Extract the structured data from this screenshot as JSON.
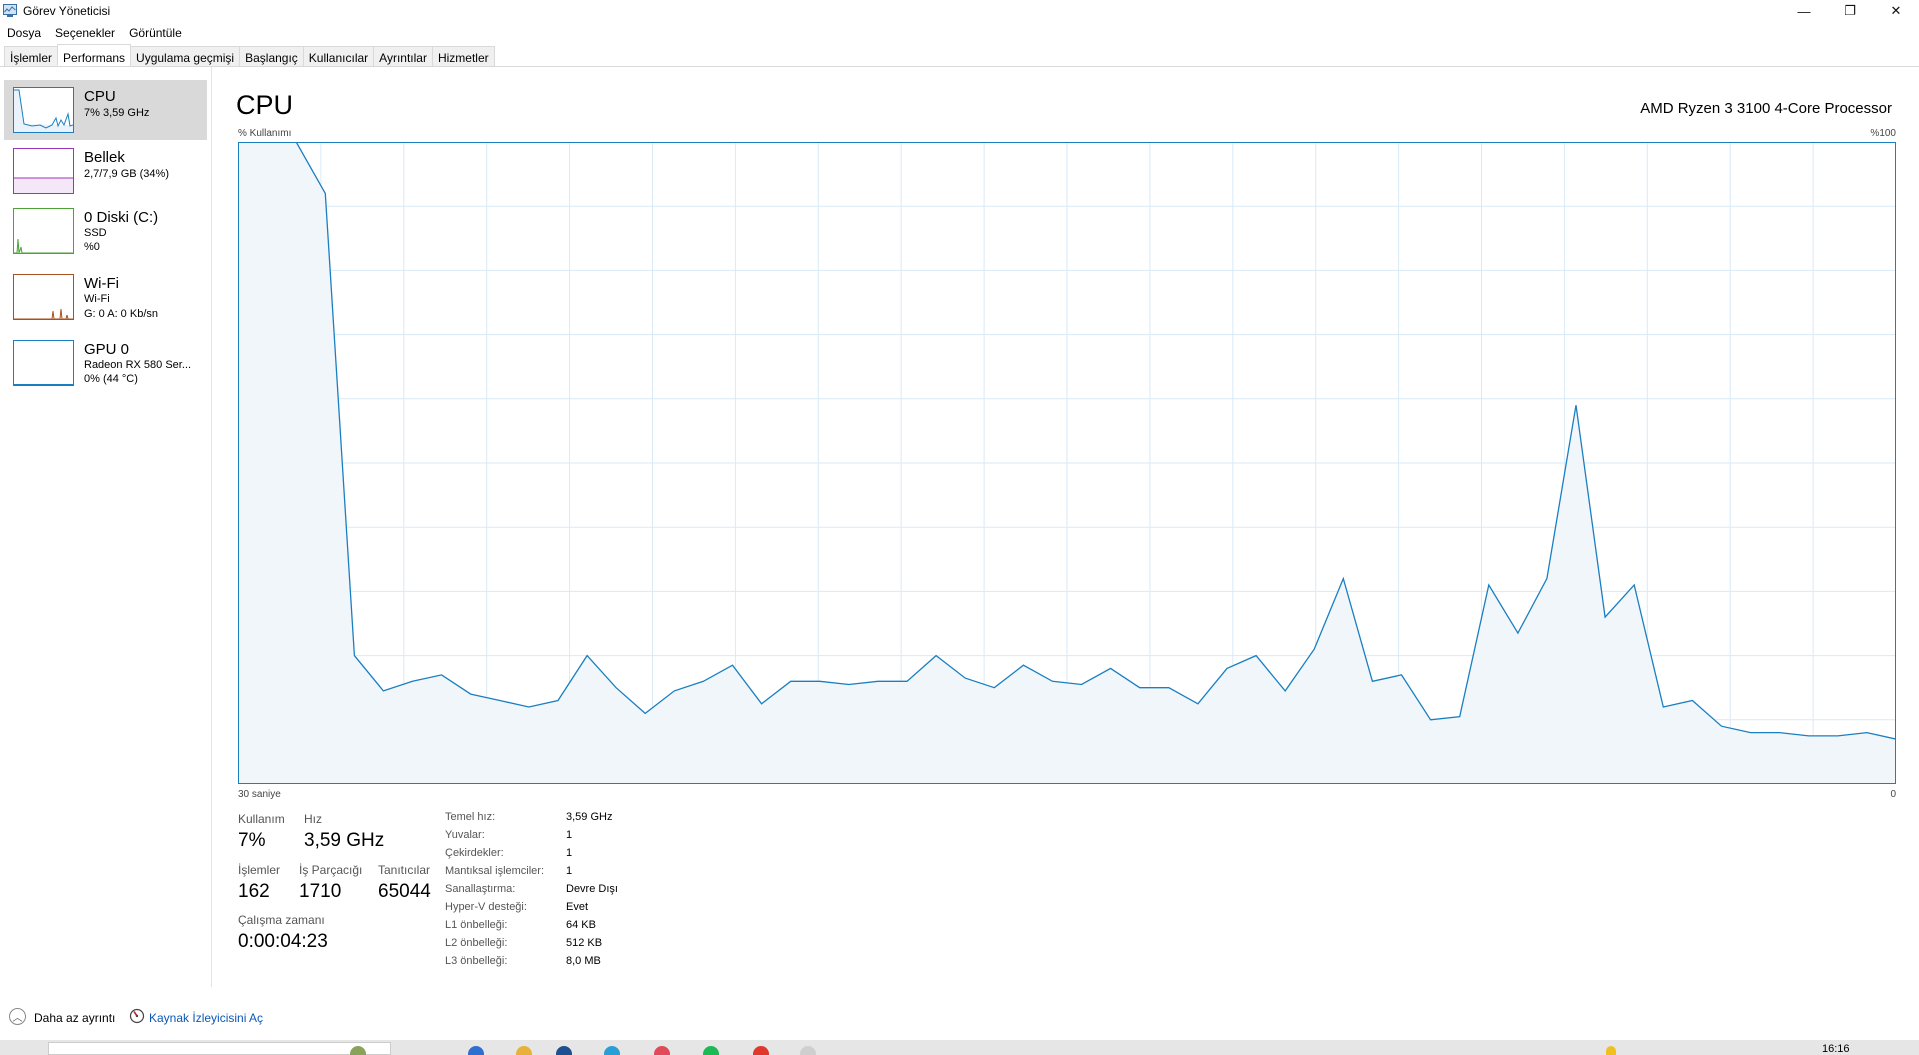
{
  "window": {
    "title": "Görev Yöneticisi",
    "controls": {
      "minimize": "—",
      "restore": "❐",
      "close": "✕"
    }
  },
  "menu": [
    "Dosya",
    "Seçenekler",
    "Görüntüle"
  ],
  "tabs": [
    {
      "label": "İşlemler",
      "active": false
    },
    {
      "label": "Performans",
      "active": true
    },
    {
      "label": "Uygulama geçmişi",
      "active": false
    },
    {
      "label": "Başlangıç",
      "active": false
    },
    {
      "label": "Kullanıcılar",
      "active": false
    },
    {
      "label": "Ayrıntılar",
      "active": false
    },
    {
      "label": "Hizmetler",
      "active": false
    }
  ],
  "sidebar": [
    {
      "title": "CPU",
      "lines": [
        "7% 3,59 GHz"
      ],
      "color": "#1a7fc1",
      "active": true
    },
    {
      "title": "Bellek",
      "lines": [
        "2,7/7,9 GB (34%)"
      ],
      "color": "#9b35b8",
      "active": false
    },
    {
      "title": "0 Diski (C:)",
      "lines": [
        "SSD",
        "%0"
      ],
      "color": "#4da33a",
      "active": false
    },
    {
      "title": "Wi-Fi",
      "lines": [
        "Wi-Fi",
        "G: 0 A: 0 Kb/sn"
      ],
      "color": "#a7521e",
      "active": false
    },
    {
      "title": "GPU 0",
      "lines": [
        "Radeon RX 580 Ser...",
        "0% (44 °C)"
      ],
      "color": "#1a7fc1",
      "active": false
    }
  ],
  "main": {
    "title": "CPU",
    "processor": "AMD Ryzen 3 3100 4-Core Processor",
    "graph_label_left": "% Kullanımı",
    "graph_label_right": "%100",
    "graph_time_label": "30 saniye",
    "graph_zero_label": "0"
  },
  "chart_data": {
    "type": "area",
    "ylim": [
      0,
      100
    ],
    "y": [
      100,
      100,
      100,
      92,
      20,
      14.5,
      16,
      17,
      14,
      13,
      12,
      13,
      20,
      15,
      11,
      14.5,
      16,
      18.5,
      12.5,
      16,
      16,
      15.5,
      16,
      16,
      20,
      16.5,
      15,
      18.5,
      16,
      15.5,
      18,
      15,
      15,
      12.5,
      18,
      20,
      14.5,
      21,
      32,
      16,
      17,
      10,
      10.5,
      31,
      23.5,
      32,
      59,
      26,
      31,
      12,
      13,
      9,
      8,
      8,
      7.5,
      7.5,
      8,
      7
    ],
    "color": "#1a7fc1",
    "fill": "#f1f6fb",
    "grid": true
  },
  "stats": {
    "usage_label": "Kullanım",
    "usage_value": "7%",
    "speed_label": "Hız",
    "speed_value": "3,59 GHz",
    "processes_label": "İşlemler",
    "processes_value": "162",
    "threads_label": "İş Parçacığı",
    "threads_value": "1710",
    "handles_label": "Tanıtıcılar",
    "handles_value": "65044",
    "uptime_label": "Çalışma zamanı",
    "uptime_value": "0:00:04:23"
  },
  "details": [
    {
      "label": "Temel hız:",
      "value": "3,59 GHz"
    },
    {
      "label": "Yuvalar:",
      "value": "1"
    },
    {
      "label": "Çekirdekler:",
      "value": "1"
    },
    {
      "label": "Mantıksal işlemciler:",
      "value": "1"
    },
    {
      "label": "Sanallaştırma:",
      "value": "Devre Dışı"
    },
    {
      "label": "Hyper-V desteği:",
      "value": "Evet"
    },
    {
      "label": "L1 önbelleği:",
      "value": "64 KB"
    },
    {
      "label": "L2 önbelleği:",
      "value": "512 KB"
    },
    {
      "label": "L3 önbelleği:",
      "value": "8,0 MB"
    }
  ],
  "footer": {
    "less_detail": "Daha az ayrıntı",
    "resource_monitor": "Kaynak İzleyicisini Aç"
  },
  "taskbar": {
    "clock": "16:16"
  }
}
